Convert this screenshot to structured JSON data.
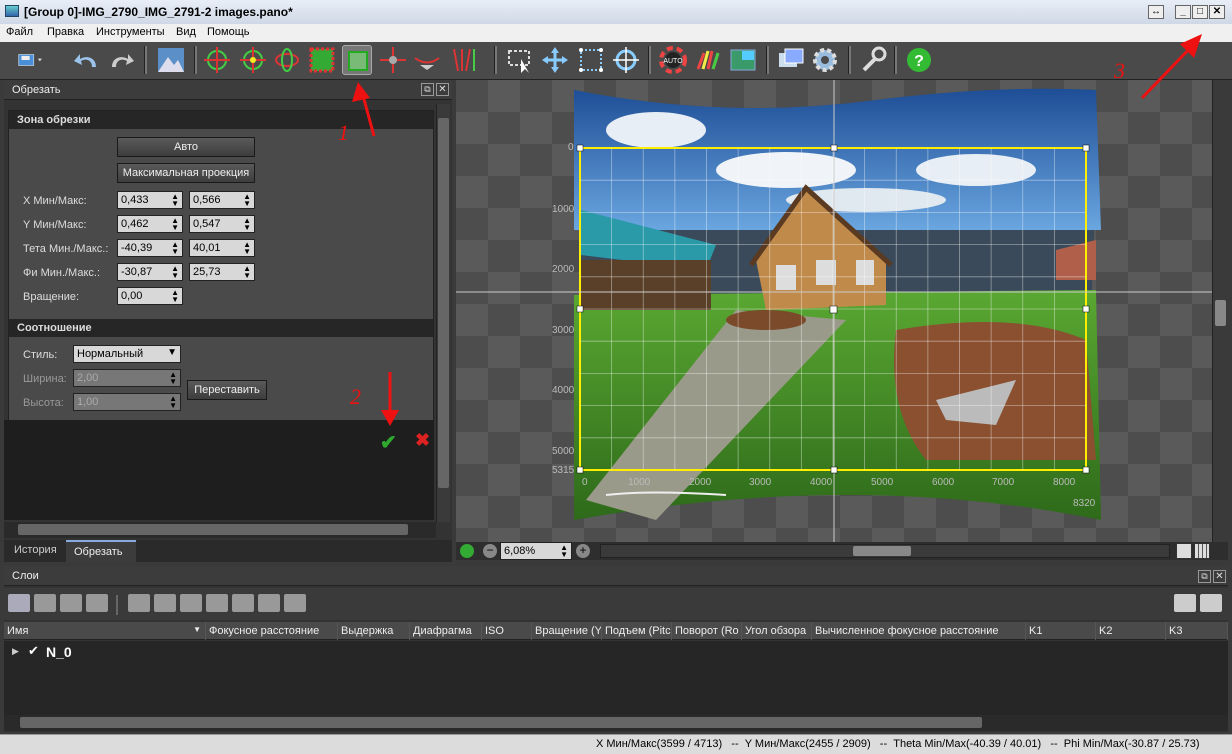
{
  "window": {
    "title": "[Group 0]-IMG_2790_IMG_2791-2 images.pano*"
  },
  "menu": [
    "Файл",
    "Правка",
    "Инструменты",
    "Вид",
    "Помощь"
  ],
  "crop_panel": {
    "title": "Обрезать",
    "zone_section": "Зона обрезки",
    "auto_button": "Авто",
    "maxproj_button": "Максимальная проекция",
    "rows": [
      {
        "label": "X Мин/Макс:",
        "min": "0,433",
        "max": "0,566"
      },
      {
        "label": "Y Мин/Макс:",
        "min": "0,462",
        "max": "0,547"
      },
      {
        "label": "Тета Мин./Макс.:",
        "min": "-40,39",
        "max": "40,01"
      },
      {
        "label": "Фи Мин./Макс.:",
        "min": "-30,87",
        "max": "25,73"
      }
    ],
    "rotation_label": "Вращение:",
    "rotation_value": "0,00",
    "ratio_section": "Соотношение",
    "style_label": "Стиль:",
    "style_value": "Нормальный",
    "width_label": "Ширина:",
    "width_value": "2,00",
    "height_label": "Высота:",
    "height_value": "1,00",
    "swap_button": "Переставить"
  },
  "tabs": [
    "История",
    "Обрезать"
  ],
  "annotations": [
    "1",
    "2",
    "3"
  ],
  "ruler": {
    "y_ticks": [
      "0",
      "1000",
      "2000",
      "3000",
      "4000",
      "5000",
      "5315"
    ],
    "x_ticks": [
      "0",
      "1000",
      "2000",
      "3000",
      "4000",
      "5000",
      "6000",
      "7000",
      "8000"
    ],
    "x_end": "8320"
  },
  "zoom": "6,08%",
  "layers": {
    "title": "Слои",
    "columns": [
      "Имя",
      "Фокусное расстояние",
      "Выдержка",
      "Диафрагма",
      "ISO",
      "Вращение (Y",
      "Подъем (Pitc",
      "Поворот (Ro",
      "Угол обзора",
      "Вычисленное фокусное расстояние",
      "K1",
      "K2",
      "K3"
    ],
    "row_name": "N_0"
  },
  "status": "X Мин/Макс(3599 / 4713)   --  Y Мин/Макс(2455 / 2909)   --  Theta Min/Max(-40.39 / 40.01)   --  Phi Min/Max(-30.87 / 25.73)",
  "colors": {
    "accent_yellow": "#ffee00",
    "check_green": "#2eaa2e",
    "cross_red": "#dd2222",
    "arrow_red": "#ee1111"
  }
}
